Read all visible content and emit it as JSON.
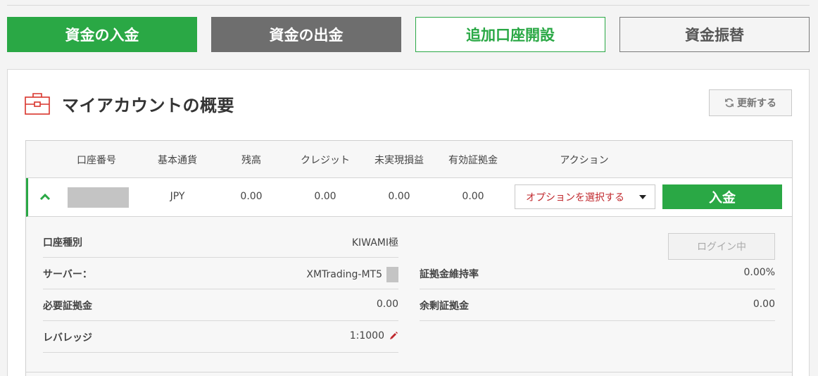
{
  "top_buttons": {
    "deposit": "資金の入金",
    "withdraw": "資金の出金",
    "add_account": "追加口座開設",
    "transfer": "資金振替"
  },
  "overview": {
    "title": "マイアカウントの概要",
    "refresh_label": "更新する"
  },
  "table": {
    "headers": [
      "口座番号",
      "基本通貨",
      "残高",
      "クレジット",
      "未実現損益",
      "有効証拠金",
      "アクション"
    ],
    "row": {
      "currency": "JPY",
      "balance": "0.00",
      "credit": "0.00",
      "unrealized": "0.00",
      "equity": "0.00",
      "select_label": "オプションを選択する",
      "deposit_label": "入金"
    }
  },
  "details": {
    "account_type_label": "口座種別",
    "account_type_value": "KIWAMI極",
    "server_label": "サーバー：",
    "server_value": "XMTrading-MT5",
    "required_margin_label": "必要証拠金",
    "required_margin_value": "0.00",
    "leverage_label": "レバレッジ",
    "leverage_value": "1:1000",
    "login_label": "ログイン中",
    "margin_level_label": "証拠金維持率",
    "margin_level_value": "0.00%",
    "free_margin_label": "余剰証拠金",
    "free_margin_value": "0.00"
  },
  "colors": {
    "green": "#2aa845",
    "gray_button": "#6e6e6e",
    "red_text": "#c0282d"
  }
}
